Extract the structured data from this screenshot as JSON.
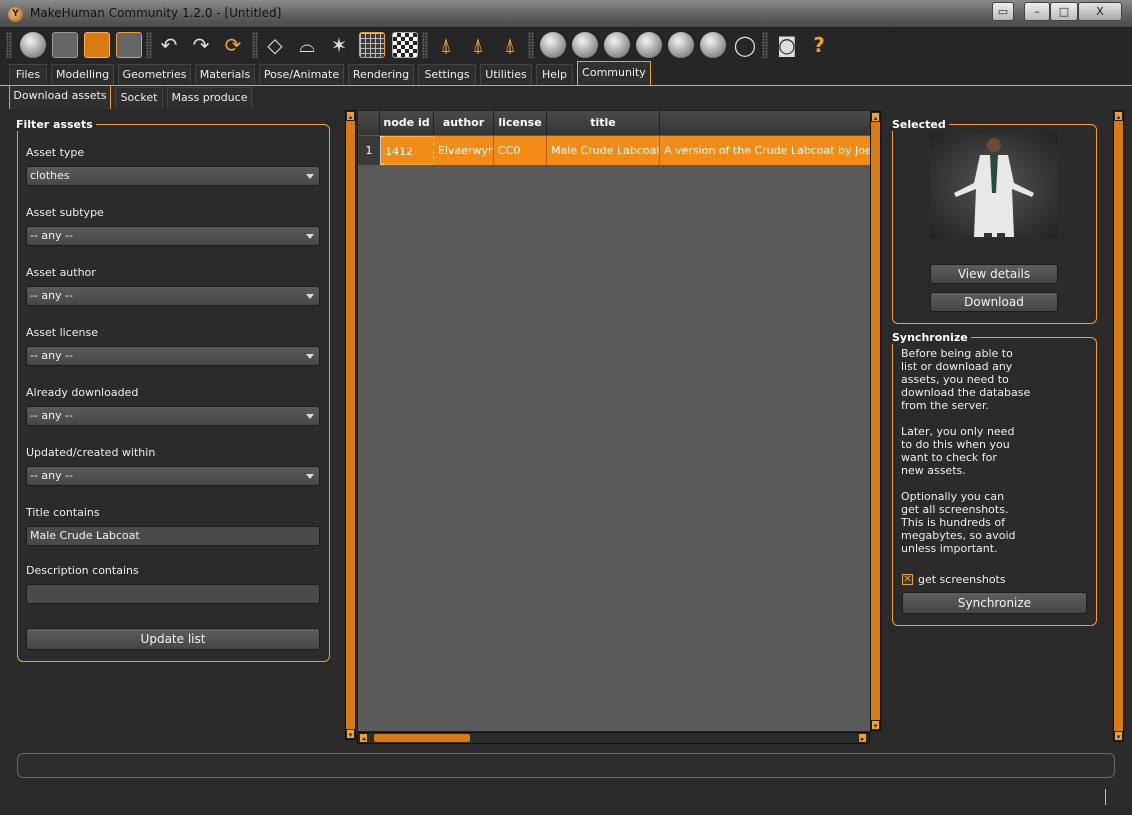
{
  "window": {
    "title": "MakeHuman Community 1.2.0 - [Untitled]",
    "app_icon_letter": "Y",
    "controls": {
      "restore": "▭",
      "minimize": "–",
      "maximize": "□",
      "close": "X"
    }
  },
  "toolbar": {
    "icons": [
      "new-icon",
      "save-icon",
      "load-icon",
      "export-icon",
      "undo-icon",
      "redo-icon",
      "reset-icon",
      "smooth-icon",
      "wireframe-icon",
      "pose-icon",
      "grid-icon",
      "background-checker-icon",
      "symmetry-right-icon",
      "symmetry-left-icon",
      "symmetry-icon",
      "front-view-icon",
      "back-view-icon",
      "left-view-icon",
      "right-view-icon",
      "top-view-icon",
      "bottom-view-icon",
      "reset-camera-icon",
      "screenshot-icon",
      "help-icon"
    ],
    "help_glyph": "?"
  },
  "tabs": [
    "Files",
    "Modelling",
    "Geometries",
    "Materials",
    "Pose/Animate",
    "Rendering",
    "Settings",
    "Utilities",
    "Help",
    "Community"
  ],
  "active_tab": "Community",
  "subtabs": [
    "Download assets",
    "Socket",
    "Mass produce"
  ],
  "active_subtab": "Download assets",
  "filter": {
    "title": "Filter assets",
    "asset_type_label": "Asset type",
    "asset_type_value": "clothes",
    "asset_subtype_label": "Asset subtype",
    "asset_subtype_value": "-- any --",
    "asset_author_label": "Asset author",
    "asset_author_value": "-- any --",
    "asset_license_label": "Asset license",
    "asset_license_value": "-- any --",
    "already_downloaded_label": "Already downloaded",
    "already_downloaded_value": "-- any --",
    "updated_within_label": "Updated/created within",
    "updated_within_value": "-- any --",
    "title_contains_label": "Title contains",
    "title_contains_value": "Male Crude Labcoat",
    "description_contains_label": "Description contains",
    "description_contains_value": "",
    "update_button": "Update list"
  },
  "table": {
    "columns": [
      "node id",
      "author",
      "license",
      "title"
    ],
    "rows": [
      {
        "row_number": "1",
        "node_id": "1412",
        "author": "Elvaerwyn",
        "license": "CC0",
        "title": "Male Crude Labcoat",
        "description": "A version of the Crude Labcoat by  Joel"
      }
    ]
  },
  "selected": {
    "title": "Selected",
    "view_details_button": "View details",
    "download_button": "Download"
  },
  "synchronize": {
    "title": "Synchronize",
    "paragraph1": [
      "Before being able to",
      "list or download any",
      "assets, you need to",
      "download the database",
      "from the server."
    ],
    "paragraph2": [
      "Later, you only need",
      "to do this when you",
      "want to check for",
      "new assets."
    ],
    "paragraph3": [
      "Optionally you can",
      "get all screenshots.",
      "This is hundreds of",
      "megabytes, so avoid",
      "unless important."
    ],
    "get_screenshots_label": "get screenshots",
    "get_screenshots_checked": true,
    "synchronize_button": "Synchronize"
  },
  "status_text": ""
}
